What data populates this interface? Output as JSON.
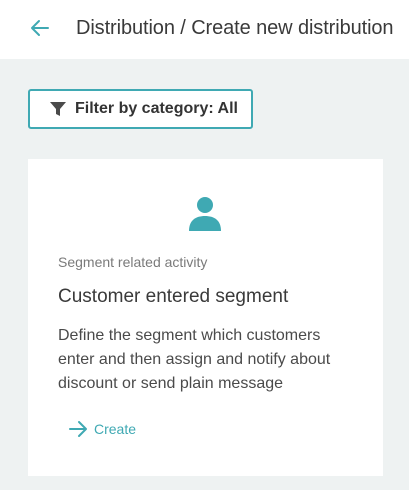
{
  "header": {
    "title": "Distribution / Create new distribution",
    "back_icon": "arrow-left-icon"
  },
  "filter": {
    "label": "Filter by category: All",
    "icon": "funnel-icon"
  },
  "card": {
    "icon": "user-icon",
    "category": "Segment related activity",
    "title": "Customer entered segment",
    "description": "Define the segment which customers enter and then assign and notify about discount or send plain message",
    "action_label": "Create",
    "action_icon": "arrow-right-icon"
  },
  "colors": {
    "accent": "#3fa9b3",
    "background": "#eef2f2",
    "card": "#ffffff"
  }
}
